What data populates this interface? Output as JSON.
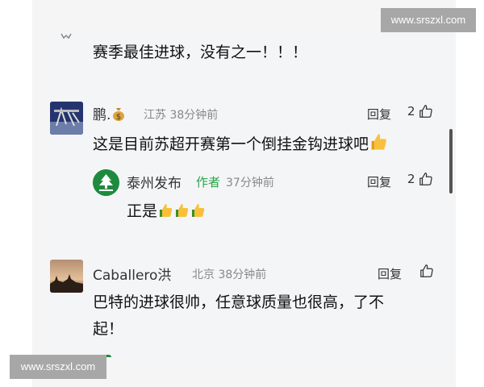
{
  "watermark": {
    "top": "www.srszxl.com",
    "bottom": "www.srszxl.com"
  },
  "comments": [
    {
      "text": "赛季最佳进球，没有之一！！！"
    },
    {
      "name": "鹏.",
      "name_emoji": "money-bag-icon",
      "location": "江苏",
      "time": "38分钟前",
      "reply_label": "回复",
      "likes": "2",
      "text": "这是目前苏超开赛第一个倒挂金钩进球吧",
      "reply": {
        "name": "泰州发布",
        "author_tag": "作者",
        "time": "37分钟前",
        "reply_label": "回复",
        "likes": "2",
        "text": "正是"
      }
    },
    {
      "name": "Caballero洪",
      "location": "北京",
      "time": "38分钟前",
      "reply_label": "回复",
      "text_line1": "巴特的进球很帅，任意球质量也很高，了不",
      "text_line2": "起！"
    }
  ],
  "colors": {
    "author_tag": "#2aa44a",
    "thumb": "#f6b21d",
    "logo_green": "#1e8a3e"
  }
}
